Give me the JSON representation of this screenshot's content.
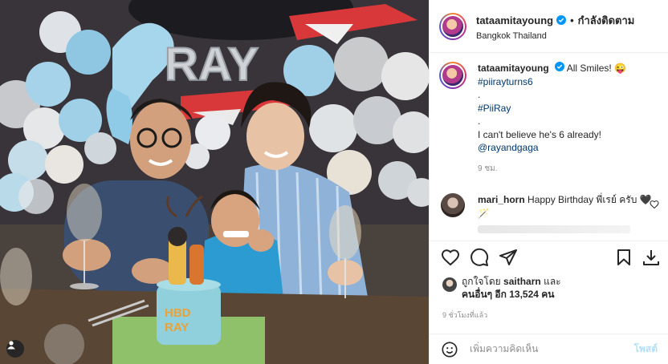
{
  "post": {
    "username": "tataamitayoung",
    "separator": "•",
    "follow_label": "กำลังติดตาม",
    "location": "Bangkok Thailand",
    "more_icon": "more-horizontal-icon"
  },
  "caption": {
    "username": "tataamitayoung",
    "text": "All Smiles! 😜",
    "hashtag1": "#piirayturns6",
    "dot1": ".",
    "hashtag2": "#PiiRay",
    "dot2": ".",
    "line": "I can't believe he's 6 already!",
    "mention": "@rayandgaga",
    "time": "9 ชม."
  },
  "comment": {
    "username": "mari_horn",
    "text": "Happy Birthday พี่เรย์ ครับ 🖤🪄"
  },
  "likes": {
    "prefix": "ถูกใจโดย",
    "user": "saitharn",
    "and": "และ",
    "others": "คนอื่นๆ อีก 13,524 คน"
  },
  "post_time": "9 ชั่วโมงที่แล้ว",
  "add_comment": {
    "placeholder": "เพิ่มความคิดเห็น",
    "post_label": "โพสต์"
  },
  "photo": {
    "balloon_text": "RAY",
    "cake_text_line1": "HBD",
    "cake_text_line2": "RAY"
  },
  "colors": {
    "link": "#00376b",
    "verified": "#0095f6",
    "muted": "#8e8e8e",
    "post_button_disabled": "#b2dffc",
    "balloon_blue": "#9fcfe6"
  }
}
